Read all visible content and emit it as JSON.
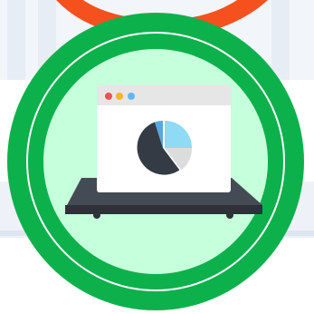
{
  "illustration": {
    "badge_icon": "laptop-pie-chart-icon",
    "colors": {
      "ring": "#0db14b",
      "ring_inner_line": "#ffffff",
      "badge_fill": "#c6ffdc",
      "ribbon": "#f4511e",
      "window": "#ffffff",
      "window_bar": "#e6e6e6",
      "dot_red": "#ef5350",
      "dot_yellow": "#f9b32a",
      "dot_blue": "#64b5f6",
      "pie_main": "#353b44",
      "pie_light_blue": "#8fdaf5",
      "pie_gray": "#dcdcdc",
      "pie_blue": "#55a9e0",
      "laptop_base": "#454b54",
      "laptop_base_dark": "#2d3138"
    }
  }
}
